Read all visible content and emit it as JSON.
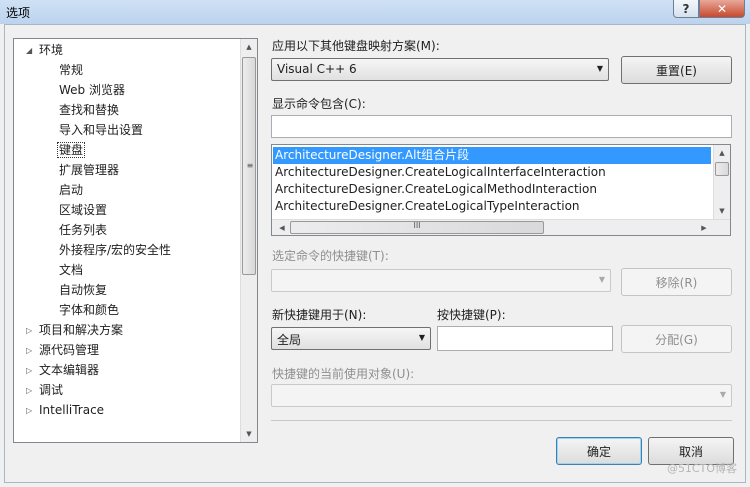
{
  "window": {
    "title": "选项",
    "help_label": "?",
    "close_label": "✕"
  },
  "tree": {
    "items": [
      {
        "label": "环境",
        "arrow": "◢"
      },
      {
        "label": "常规"
      },
      {
        "label": "Web 浏览器"
      },
      {
        "label": "查找和替换"
      },
      {
        "label": "导入和导出设置"
      },
      {
        "label": "键盘"
      },
      {
        "label": "扩展管理器"
      },
      {
        "label": "启动"
      },
      {
        "label": "区域设置"
      },
      {
        "label": "任务列表"
      },
      {
        "label": "外接程序/宏的安全性"
      },
      {
        "label": "文档"
      },
      {
        "label": "自动恢复"
      },
      {
        "label": "字体和颜色"
      },
      {
        "label": "项目和解决方案",
        "arrow": "▷"
      },
      {
        "label": "源代码管理",
        "arrow": "▷"
      },
      {
        "label": "文本编辑器",
        "arrow": "▷"
      },
      {
        "label": "调试",
        "arrow": "▷"
      },
      {
        "label": "IntelliTrace",
        "arrow": "▷"
      }
    ],
    "scroll_up": "▲",
    "scroll_down": "▼",
    "thumb_grip": "≡"
  },
  "keyboard": {
    "mapping_label": "应用以下其他键盘映射方案(M):",
    "mapping_value": "Visual C++ 6",
    "reset_button": "重置(E)",
    "show_commands_label": "显示命令包含(C):",
    "commands_filter_value": "",
    "commands": [
      "ArchitectureDesigner.Alt组合片段",
      "ArchitectureDesigner.CreateLogicalInterfaceInteraction",
      "ArchitectureDesigner.CreateLogicalMethodInteraction",
      "ArchitectureDesigner.CreateLogicalTypeInteraction"
    ],
    "list_scroll_up": "▲",
    "list_scroll_down": "▼",
    "hscroll_left": "◀",
    "hscroll_right": "▶",
    "hscroll_grip": "III",
    "shortcuts_label": "选定命令的快捷键(T):",
    "shortcuts_value": "",
    "remove_button": "移除(R)",
    "use_new_label": "新快捷键用于(N):",
    "use_new_value": "全局",
    "press_shortcut_label": "按快捷键(P):",
    "press_shortcut_value": "",
    "assign_button": "分配(G)",
    "used_by_label": "快捷键的当前使用对象(U):",
    "used_by_value": "",
    "dropdown_arrow": "▼"
  },
  "footer": {
    "ok_button": "确定",
    "cancel_button": "取消",
    "watermark": "@51CTO博客"
  }
}
